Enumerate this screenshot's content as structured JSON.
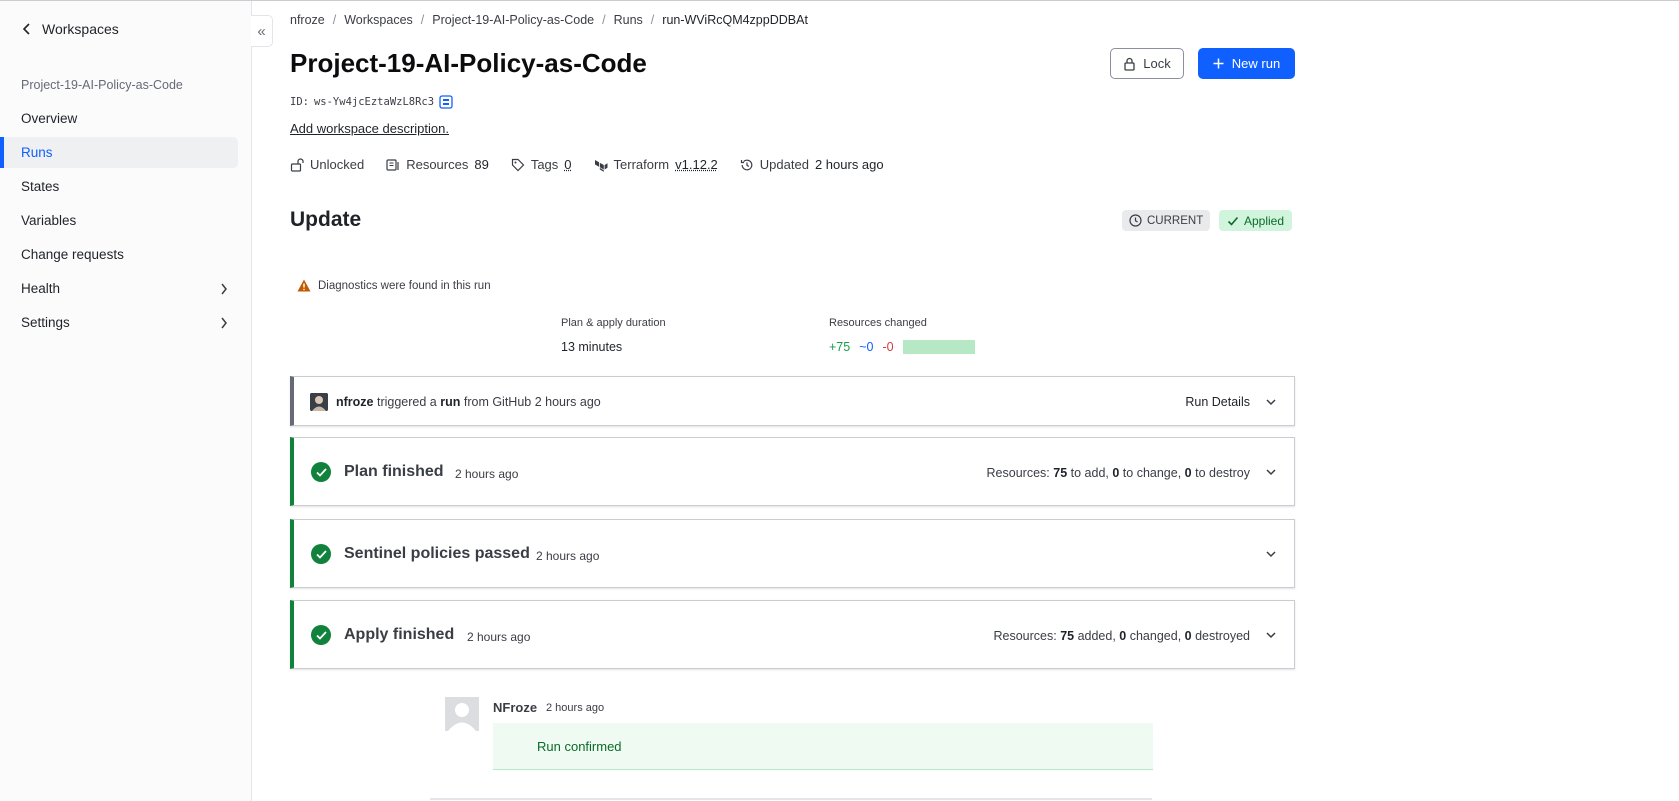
{
  "sidebar": {
    "back_label": "Workspaces",
    "workspace_name": "Project-19-AI-Policy-as-Code",
    "items": [
      {
        "label": "Overview"
      },
      {
        "label": "Runs"
      },
      {
        "label": "States"
      },
      {
        "label": "Variables"
      },
      {
        "label": "Change requests"
      },
      {
        "label": "Health"
      },
      {
        "label": "Settings"
      }
    ],
    "active_item": "Runs"
  },
  "breadcrumb": [
    "nfroze",
    "Workspaces",
    "Project-19-AI-Policy-as-Code",
    "Runs",
    "run-WViRcQM4zppDDBAt"
  ],
  "header": {
    "title": "Project-19-AI-Policy-as-Code",
    "id_label": "ID:",
    "id_value": "ws-Yw4jcEztaWzL8Rc3",
    "add_description": "Add workspace description.",
    "lock_button": "Lock",
    "new_run_button": "New run"
  },
  "meta": {
    "lock_status": "Unlocked",
    "resources_label": "Resources",
    "resources_count": "89",
    "tags_label": "Tags",
    "tags_count": "0",
    "terraform_label": "Terraform",
    "terraform_version": "v1.12.2",
    "updated_label": "Updated",
    "updated_value": "2 hours ago"
  },
  "run": {
    "title": "Update",
    "current_badge": "CURRENT",
    "status_badge": "Applied",
    "diagnostics": "Diagnostics were found in this run",
    "duration_label": "Plan & apply duration",
    "duration_value": "13 minutes",
    "resources_changed_label": "Resources changed",
    "added": "+75",
    "changed": "~0",
    "destroyed": "-0"
  },
  "trigger": {
    "user": "nfroze",
    "text1": "triggered a",
    "run_word": "run",
    "text2": "from GitHub 2 hours ago",
    "details": "Run Details"
  },
  "steps": [
    {
      "title": "Plan finished",
      "time": "2 hours ago",
      "res_prefix": "Resources:",
      "n1": "75",
      "t1": "to add,",
      "n2": "0",
      "t2": "to change,",
      "n3": "0",
      "t3": "to destroy"
    },
    {
      "title": "Sentinel policies passed",
      "time": "2 hours ago"
    },
    {
      "title": "Apply finished",
      "time": "2 hours ago",
      "res_prefix": "Resources:",
      "n1": "75",
      "t1": "added,",
      "n2": "0",
      "t2": "changed,",
      "n3": "0",
      "t3": "destroyed"
    }
  ],
  "comment": {
    "author": "NFroze",
    "time": "2 hours ago",
    "text": "Run confirmed"
  },
  "colors": {
    "accent": "#1060ff",
    "success": "#11823b",
    "add": "#11a34a",
    "destroy": "#d23c3c",
    "warning": "#c45a00"
  },
  "icons": [
    "chevron-left-icon",
    "collapse-icon",
    "copy-icon",
    "unlock-icon",
    "resources-icon",
    "tag-icon",
    "terraform-icon",
    "history-icon",
    "lock-icon",
    "plus-icon",
    "clock-icon",
    "check-icon",
    "warning-icon",
    "chevron-down-icon",
    "chevron-right-icon",
    "avatar"
  ]
}
